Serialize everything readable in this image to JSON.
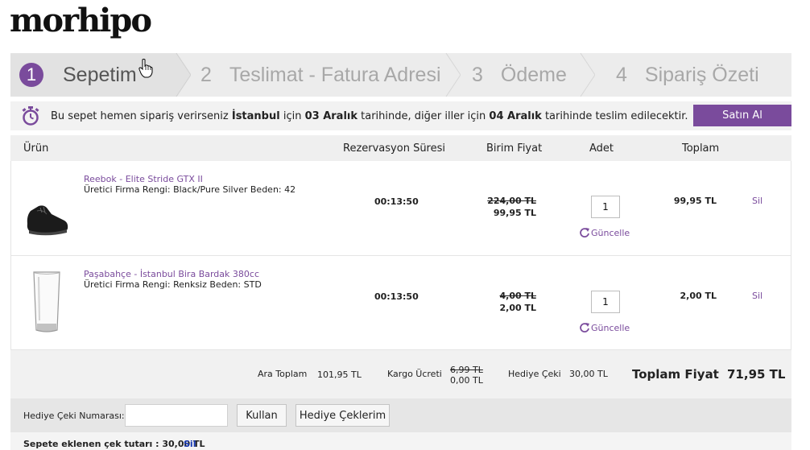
{
  "brand": {
    "logo_text": "morhipo"
  },
  "steps": [
    {
      "num": "1",
      "label": "Sepetim"
    },
    {
      "num": "2",
      "label": "Teslimat - Fatura Adresi"
    },
    {
      "num": "3",
      "label": "Ödeme"
    },
    {
      "num": "4",
      "label": "Sipariş Özeti"
    }
  ],
  "info": {
    "t1": "Bu sepet hemen sipariş verirseniz ",
    "city1": "İstanbul",
    "t2": " için ",
    "date1": "03 Aralık",
    "t3": " tarihinde, diğer iller için ",
    "date2": "04 Aralık",
    "t4": " tarihinde teslim edilecektir.",
    "buy_label": "Satın Al"
  },
  "table": {
    "headers": {
      "product": "Ürün",
      "reservation": "Rezervasyon Süresi",
      "unit_price": "Birim Fiyat",
      "qty": "Adet",
      "total": "Toplam"
    },
    "update_label": "Güncelle",
    "delete_label": "Sil",
    "items": [
      {
        "name": "Reebok - Elite Stride GTX II",
        "attr": "Üretici Firma Rengi: Black/Pure Silver  Beden: 42",
        "time": "00:13:50",
        "old_price": "224,00 TL",
        "price": "99,95 TL",
        "qty": "1",
        "total": "99,95 TL"
      },
      {
        "name": "Paşabahçe - İstanbul Bira Bardak 380cc",
        "attr": "Üretici Firma Rengi: Renksiz  Beden: STD",
        "time": "00:13:50",
        "old_price": "4,00 TL",
        "price": "2,00 TL",
        "qty": "1",
        "total": "2,00 TL"
      }
    ]
  },
  "totals": {
    "subtotal_label": "Ara Toplam",
    "subtotal": "101,95 TL",
    "shipping_label": "Kargo Ücreti",
    "shipping_old": "6,99 TL",
    "shipping": "0,00 TL",
    "gift_label": "Hediye Çeki",
    "gift": "30,00 TL",
    "grand_label": "Toplam Fiyat",
    "grand": "71,95 TL"
  },
  "gift_voucher": {
    "label": "Hediye Çeki Numarası:",
    "input_value": "",
    "use_label": "Kullan",
    "my_vouchers_label": "Hediye Çeklerim",
    "added_text": "Sepete eklenen çek tutarı : 30,00 TL",
    "remove_label": "Sil"
  },
  "colors": {
    "accent": "#7a4b9c",
    "link_blue": "#1a3bb5"
  },
  "icons": [
    "stopwatch-icon",
    "refresh-icon",
    "hand-cursor-icon",
    "shoe-image",
    "glass-image"
  ]
}
